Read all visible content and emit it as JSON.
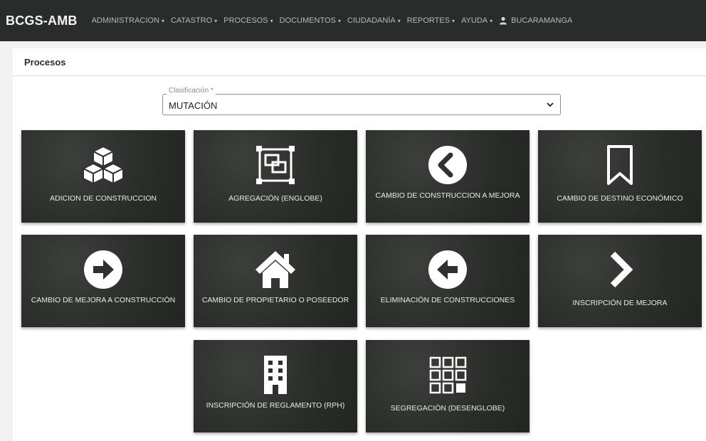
{
  "navbar": {
    "brand": "BCGS-AMB",
    "items": [
      {
        "label": "ADMINISTRACION"
      },
      {
        "label": "CATASTRO"
      },
      {
        "label": "PROCESOS"
      },
      {
        "label": "DOCUMENTOS"
      },
      {
        "label": "CIUDADANÍA"
      },
      {
        "label": "REPORTES"
      },
      {
        "label": "AYUDA"
      }
    ],
    "user": "BUCARAMANGA"
  },
  "panel": {
    "title": "Procesos"
  },
  "classification": {
    "label": "Clasificación *",
    "value": "MUTACIÓN"
  },
  "tiles": [
    {
      "label": "ADICION DE CONSTRUCCION",
      "icon": "cubes-icon"
    },
    {
      "label": "AGREGACIÓN (ENGLOBE)",
      "icon": "merge-squares-icon"
    },
    {
      "label": "CAMBIO DE CONSTRUCCION A MEJORA",
      "icon": "circle-chevron-left-icon"
    },
    {
      "label": "CAMBIO DE DESTINO ECONÓMICO",
      "icon": "bookmark-icon"
    },
    {
      "label": "CAMBIO DE MEJORA A CONSTRUCCIÓN",
      "icon": "circle-arrow-right-icon"
    },
    {
      "label": "CAMBIO DE PROPIETARIO O POSEEDOR",
      "icon": "home-icon"
    },
    {
      "label": "ELIMINACIÓN DE CONSTRUCCIONES",
      "icon": "circle-arrow-left-icon"
    },
    {
      "label": "INSCRIPCIÓN DE MEJORA",
      "icon": "chevron-right-icon"
    },
    {
      "label": "INSCRIPCIÓN DE REGLAMENTO (RPH)",
      "icon": "building-icon"
    },
    {
      "label": "SEGREGACIÓN (DESENGLOBE)",
      "icon": "grid-squares-icon"
    }
  ]
}
